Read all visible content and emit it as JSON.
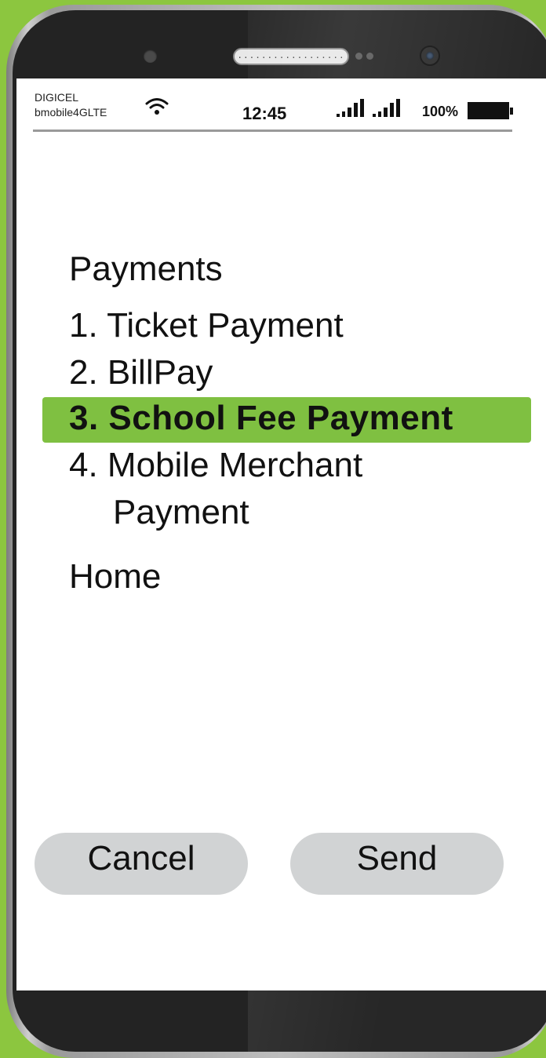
{
  "colors": {
    "background": "#8cc63f",
    "highlight": "#7fc041",
    "button": "#d1d3d4"
  },
  "status": {
    "carrier_line1": "DIGICEL",
    "carrier_line2": "bmobile4GLTE",
    "time": "12:45",
    "battery": "100%",
    "icons": [
      "wifi-icon",
      "signal-icon",
      "signal-icon",
      "battery-icon"
    ]
  },
  "menu": {
    "title": "Payments",
    "items": [
      {
        "label": "1. Ticket Payment"
      },
      {
        "label": "2. BillPay"
      },
      {
        "label": "3. School Fee Payment",
        "selected": true
      },
      {
        "label": "4. Mobile Merchant",
        "label_line2": "Payment"
      }
    ],
    "home": "Home"
  },
  "buttons": {
    "cancel": "Cancel",
    "send": "Send"
  }
}
